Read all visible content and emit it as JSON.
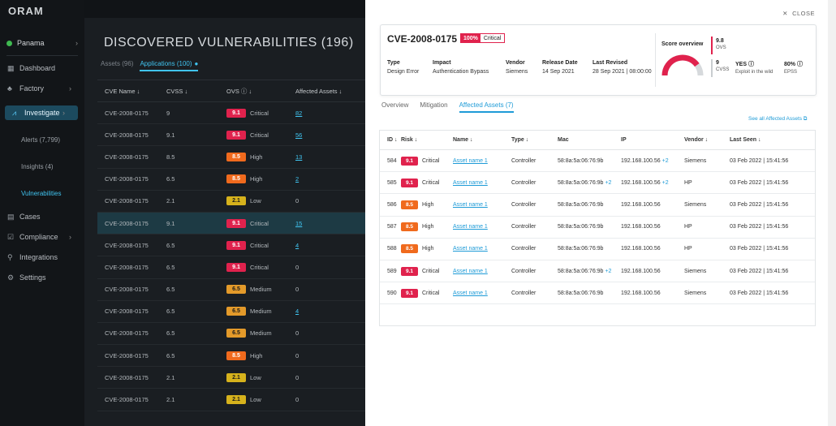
{
  "app": {
    "logo": "ORAM"
  },
  "sidebar": {
    "site": "Panama",
    "items": [
      {
        "label": "Dashboard",
        "icon": "▦",
        "chev": ""
      },
      {
        "label": "Factory",
        "icon": "♣",
        "chev": "›"
      },
      {
        "label": "Investigate",
        "icon": "⩘",
        "chev": "›"
      },
      {
        "label": "Cases",
        "icon": "▤",
        "chev": ""
      },
      {
        "label": "Compliance",
        "icon": "☑",
        "chev": "›"
      },
      {
        "label": "Integrations",
        "icon": "⚲",
        "chev": ""
      },
      {
        "label": "Settings",
        "icon": "⚙",
        "chev": ""
      }
    ],
    "sub_items": [
      "Alerts (7,799)",
      "Insights (4)",
      "Vulnerabilities"
    ]
  },
  "main": {
    "title": "DISCOVERED VULNERABILITIES  (196)",
    "tabs": [
      "Assets (96)",
      "Applications (100)"
    ],
    "columns": [
      "CVE Name ↓",
      "CVSS ↓",
      "OVS ⓘ ↓",
      "Affected Assets ↓"
    ],
    "rows": [
      {
        "cve": "CVE-2008-0175",
        "cvss": "9",
        "ovs": "9.1",
        "sev": "Critical",
        "assets": "82"
      },
      {
        "cve": "CVE-2008-0175",
        "cvss": "9.1",
        "ovs": "9.1",
        "sev": "Critical",
        "assets": "56"
      },
      {
        "cve": "CVE-2008-0175",
        "cvss": "8.5",
        "ovs": "8.5",
        "sev": "High",
        "assets": "13"
      },
      {
        "cve": "CVE-2008-0175",
        "cvss": "6.5",
        "ovs": "8.5",
        "sev": "High",
        "assets": "2"
      },
      {
        "cve": "CVE-2008-0175",
        "cvss": "2.1",
        "ovs": "2.1",
        "sev": "Low",
        "assets": "0"
      },
      {
        "cve": "CVE-2008-0175",
        "cvss": "9.1",
        "ovs": "9.1",
        "sev": "Critical",
        "assets": "15"
      },
      {
        "cve": "CVE-2008-0175",
        "cvss": "6.5",
        "ovs": "9.1",
        "sev": "Critical",
        "assets": "4"
      },
      {
        "cve": "CVE-2008-0175",
        "cvss": "6.5",
        "ovs": "9.1",
        "sev": "Critical",
        "assets": "0"
      },
      {
        "cve": "CVE-2008-0175",
        "cvss": "6.5",
        "ovs": "6.5",
        "sev": "Medium",
        "assets": "0"
      },
      {
        "cve": "CVE-2008-0175",
        "cvss": "6.5",
        "ovs": "6.5",
        "sev": "Medium",
        "assets": "4"
      },
      {
        "cve": "CVE-2008-0175",
        "cvss": "6.5",
        "ovs": "6.5",
        "sev": "Medium",
        "assets": "0"
      },
      {
        "cve": "CVE-2008-0175",
        "cvss": "6.5",
        "ovs": "8.5",
        "sev": "High",
        "assets": "0"
      },
      {
        "cve": "CVE-2008-0175",
        "cvss": "2.1",
        "ovs": "2.1",
        "sev": "Low",
        "assets": "0"
      },
      {
        "cve": "CVE-2008-0175",
        "cvss": "2.1",
        "ovs": "2.1",
        "sev": "Low",
        "assets": "0"
      }
    ]
  },
  "drawer": {
    "close_label": "CLOSE",
    "cve": "CVE-2008-0175",
    "pct": "100%",
    "severity": "Critical",
    "meta": [
      {
        "k": "Type",
        "v": "Design Error"
      },
      {
        "k": "Impact",
        "v": "Authentication Bypass"
      },
      {
        "k": "Vendor",
        "v": "Siemens"
      },
      {
        "k": "Release Date",
        "v": "14 Sep 2021"
      },
      {
        "k": "Last Revised",
        "v": "28 Sep 2021 | 08:00:00"
      }
    ],
    "score": {
      "title": "Score overview",
      "ovs": "9.8",
      "ovs_label": "OVS",
      "cvss": "9",
      "cvss_label": "CVSS",
      "exploit": "YES ⓘ",
      "exploit_label": "Exploit in the wild",
      "epss": "80% ⓘ",
      "epss_label": "EPSS",
      "gauge_fraction": 0.8
    },
    "tabs": [
      "Overview",
      "Mitigation",
      "Affected Assets (7)"
    ],
    "see_all": "See all Affected Assets ⧉",
    "columns": [
      "ID ↓",
      "Risk ↓",
      "Name ↓",
      "Type ↓",
      "Mac",
      "IP",
      "Vendor ↓",
      "Last Seen ↓"
    ],
    "rows": [
      {
        "id": "584",
        "risk": "9.1",
        "sev": "Critical",
        "name": "Asset name 1",
        "type": "Controller",
        "mac": "58:8a:5a:06:76:9b",
        "ip": "192.168.100.56",
        "ip_more": "+2",
        "vendor": "Siemens",
        "seen": "03 Feb 2022 | 15:41:56"
      },
      {
        "id": "585",
        "risk": "9.1",
        "sev": "Critical",
        "name": "Asset name 1",
        "type": "Controller",
        "mac": "58:8a:5a:06:76:9b",
        "mac_more": "+2",
        "ip": "192.168.100.56",
        "ip_more": "+2",
        "vendor": "HP",
        "seen": "03 Feb 2022 | 15:41:56"
      },
      {
        "id": "586",
        "risk": "8.5",
        "sev": "High",
        "name": "Asset name 1",
        "type": "Controller",
        "mac": "58:8a:5a:06:76:9b",
        "ip": "192.168.100.56",
        "vendor": "Siemens",
        "seen": "03 Feb 2022 | 15:41:56"
      },
      {
        "id": "587",
        "risk": "8.5",
        "sev": "High",
        "name": "Asset name 1",
        "type": "Controller",
        "mac": "58:8a:5a:06:76:9b",
        "ip": "192.168.100.56",
        "vendor": "HP",
        "seen": "03 Feb 2022 | 15:41:56"
      },
      {
        "id": "588",
        "risk": "8.5",
        "sev": "High",
        "name": "Asset name 1",
        "type": "Controller",
        "mac": "58:8a:5a:06:76:9b",
        "ip": "192.168.100.56",
        "vendor": "HP",
        "seen": "03 Feb 2022 | 15:41:56"
      },
      {
        "id": "589",
        "risk": "9.1",
        "sev": "Critical",
        "name": "Asset name 1",
        "type": "Controller",
        "mac": "58:8a:5a:06:76:9b",
        "mac_more": "+2",
        "ip": "192.168.100.56",
        "vendor": "Siemens",
        "seen": "03 Feb 2022 | 15:41:56"
      },
      {
        "id": "590",
        "risk": "9.1",
        "sev": "Critical",
        "name": "Asset name 1",
        "type": "Controller",
        "mac": "58:8a:5a:06:76:9b",
        "ip": "192.168.100.56",
        "vendor": "Siemens",
        "seen": "03 Feb 2022 | 15:41:56"
      }
    ]
  },
  "colors": {
    "critical": "#e0224d",
    "high": "#f06a1d",
    "medium": "#e39a2a",
    "low": "#d6b21c",
    "accent": "#40c4f0"
  }
}
